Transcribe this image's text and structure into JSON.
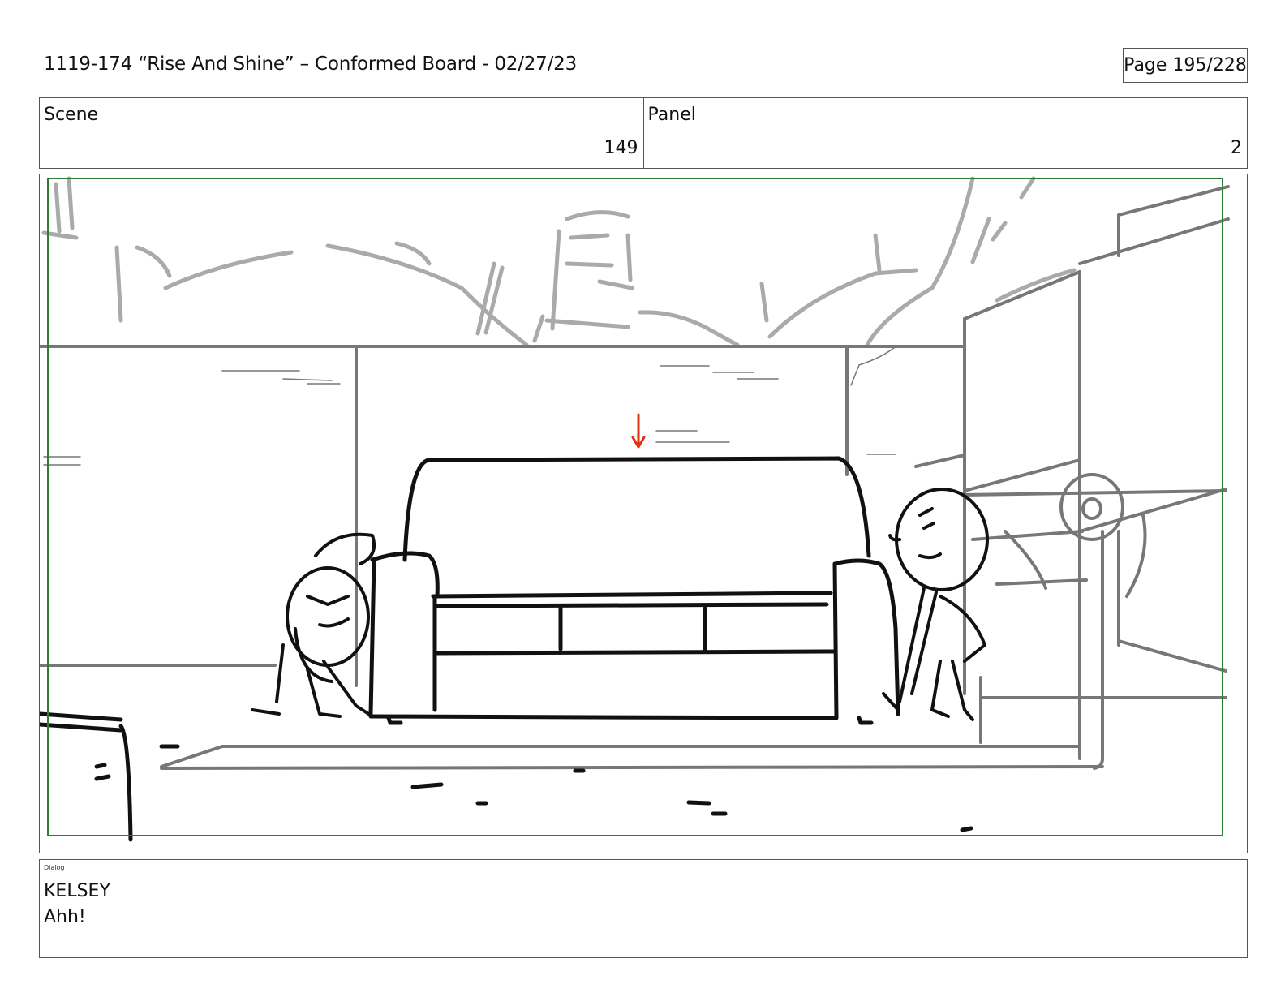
{
  "header": {
    "title": "1119-174 “Rise And Shine” – Conformed Board - 02/27/23",
    "page": "Page 195/228"
  },
  "info": {
    "scene_label": "Scene",
    "scene_value": "149",
    "panel_label": "Panel",
    "panel_value": "2"
  },
  "dialog": {
    "label": "Dialog",
    "speaker": "KELSEY",
    "line": "Ahh!"
  },
  "colors": {
    "safe_area": "#2e7d32",
    "arrow": "#e53010",
    "sketch_dark": "#111111",
    "sketch_mid": "#777777",
    "sketch_light": "#aaaaaa"
  }
}
